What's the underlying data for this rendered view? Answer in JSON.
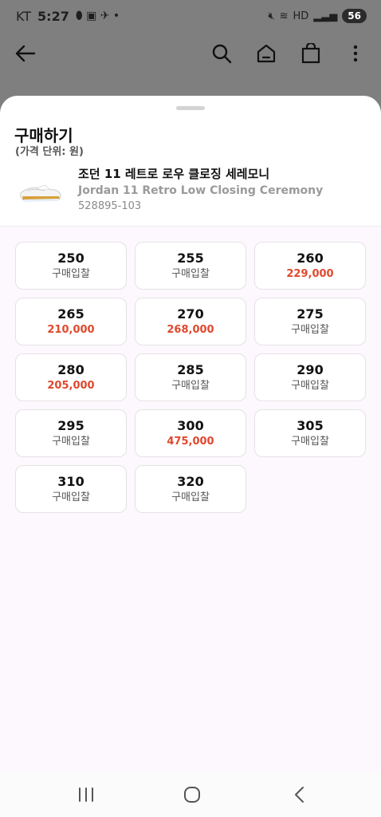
{
  "status_bar": {
    "carrier": "KT",
    "time": "5:27",
    "battery": "56"
  },
  "icons": {
    "back": "arrow-left-icon",
    "search": "search-icon",
    "home": "home-icon",
    "cart": "shopping-bag-icon",
    "more": "more-vertical-icon"
  },
  "sheet": {
    "title": "구매하기",
    "subtitle": "(가격 단위: 원)"
  },
  "product": {
    "name_ko": "조던 11 레트로 로우 클로징 세레모니",
    "name_en": "Jordan 11 Retro Low Closing Ceremony",
    "sku": "528895-103"
  },
  "sizes": [
    {
      "size": "250",
      "price": "구매입찰",
      "has_price": false
    },
    {
      "size": "255",
      "price": "구매입찰",
      "has_price": false
    },
    {
      "size": "260",
      "price": "229,000",
      "has_price": true
    },
    {
      "size": "265",
      "price": "210,000",
      "has_price": true
    },
    {
      "size": "270",
      "price": "268,000",
      "has_price": true
    },
    {
      "size": "275",
      "price": "구매입찰",
      "has_price": false
    },
    {
      "size": "280",
      "price": "205,000",
      "has_price": true
    },
    {
      "size": "285",
      "price": "구매입찰",
      "has_price": false
    },
    {
      "size": "290",
      "price": "구매입찰",
      "has_price": false
    },
    {
      "size": "295",
      "price": "구매입찰",
      "has_price": false
    },
    {
      "size": "300",
      "price": "475,000",
      "has_price": true
    },
    {
      "size": "305",
      "price": "구매입찰",
      "has_price": false
    },
    {
      "size": "310",
      "price": "구매입찰",
      "has_price": false
    },
    {
      "size": "320",
      "price": "구매입찰",
      "has_price": false
    }
  ],
  "colors": {
    "price_accent": "#e0482e",
    "options_bg": "#fdf8fd",
    "scrim": "#7f7f7f"
  }
}
